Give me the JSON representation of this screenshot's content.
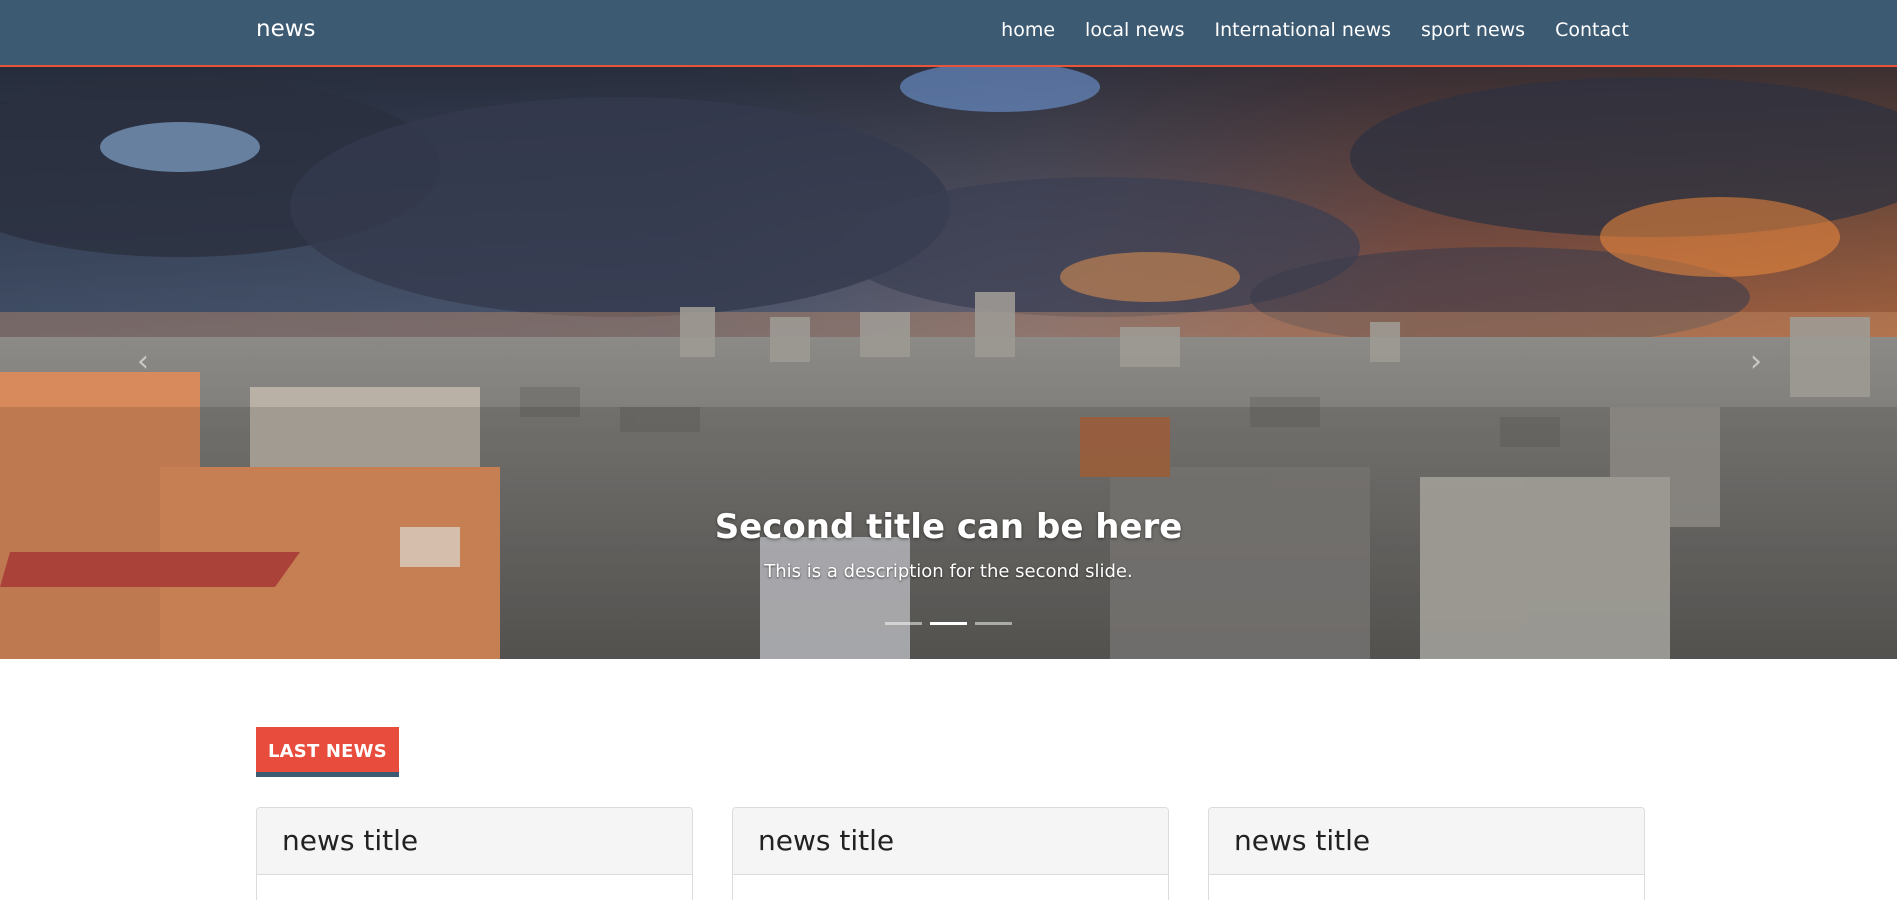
{
  "navbar": {
    "brand": "news",
    "links": [
      "home",
      "local news",
      "International news",
      "sport news",
      "Contact"
    ]
  },
  "carousel": {
    "title": "Second title can be here",
    "description": "This is a description for the second slide.",
    "prev_icon": "chevron-left-icon",
    "next_icon": "chevron-right-icon",
    "indicator_count": 3,
    "active_index": 1
  },
  "section": {
    "label": "LAST NEWS"
  },
  "cards": [
    {
      "title": "news title"
    },
    {
      "title": "news title"
    },
    {
      "title": "news title"
    }
  ],
  "colors": {
    "navbar": "#3d5a73",
    "accent": "#e74c3c"
  }
}
